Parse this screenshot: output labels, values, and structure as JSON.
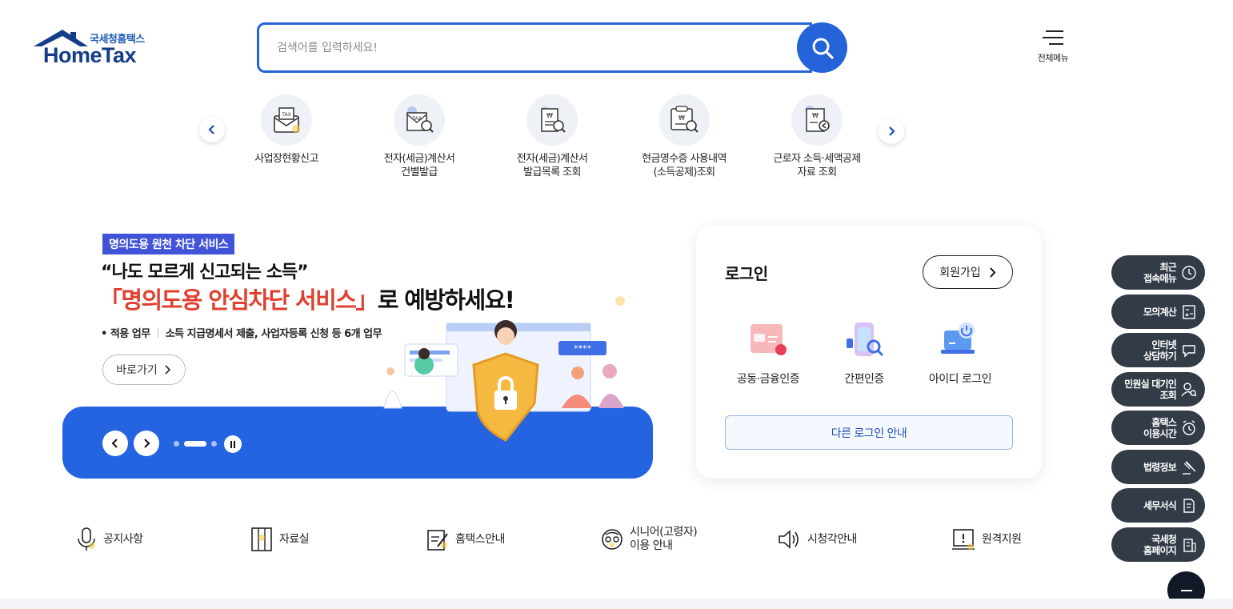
{
  "header": {
    "logo_small": "국세청홈택스",
    "logo_big": "HomeTax",
    "search_placeholder": "검색어를 입력하세요!",
    "all_menu_label": "전체메뉴"
  },
  "quick_menu": {
    "items": [
      {
        "label": "사업장현황신고",
        "icon": "tax-envelope-icon"
      },
      {
        "label": "전자(세금)계산서\n건별발급",
        "icon": "tax-invoice-search-icon"
      },
      {
        "label": "전자(세금)계산서\n발급목록 조회",
        "icon": "invoice-list-search-icon"
      },
      {
        "label": "현금영수증 사용내역\n(소득공제)조회",
        "icon": "receipt-search-icon"
      },
      {
        "label": "근로자 소득·세액공제\n자료 조회",
        "icon": "deduction-document-icon"
      }
    ]
  },
  "banner": {
    "tag": "명의도용 원천 차단 서비스",
    "subtitle": "“나도 모르게 신고되는 소득”",
    "main_highlight": "「명의도용 안심차단 서비스」",
    "main_rest": "로 예방하세요!",
    "detail_prefix": "• 적용 업무",
    "detail_text": "소득 지급명세서 제출, 사업자등록 신청 등 6개 업무",
    "go_label": "바로가기",
    "illustration_code": "****"
  },
  "login": {
    "title": "로그인",
    "join_label": "회원가입",
    "options": [
      {
        "label": "공동·금융인증",
        "icon": "certificate-icon"
      },
      {
        "label": "간편인증",
        "icon": "simple-auth-icon"
      },
      {
        "label": "아이디 로그인",
        "icon": "id-login-icon"
      }
    ],
    "other_login": "다른 로그인 안내"
  },
  "bottom_links": [
    {
      "label": "공지사항",
      "icon": "microphone-icon"
    },
    {
      "label": "자료실",
      "icon": "archive-icon"
    },
    {
      "label": "홈택스안내",
      "icon": "guide-edit-icon"
    },
    {
      "label": "시니어(고령자)\n이용 안내",
      "icon": "senior-icon"
    },
    {
      "label": "시청각안내",
      "icon": "speaker-icon"
    },
    {
      "label": "원격지원",
      "icon": "remote-support-icon"
    }
  ],
  "right_menu": [
    {
      "label": "최근\n접속메뉴",
      "icon": "clock-icon"
    },
    {
      "label": "모의계산",
      "icon": "calculator-icon"
    },
    {
      "label": "인터넷\n상담하기",
      "icon": "chat-icon"
    },
    {
      "label": "민원실 대기인\n조회",
      "icon": "person-search-icon"
    },
    {
      "label": "홈택스\n이용시간",
      "icon": "alarm-clock-icon"
    },
    {
      "label": "법령정보",
      "icon": "gavel-icon"
    },
    {
      "label": "세무서식",
      "icon": "form-document-icon"
    },
    {
      "label": "국세청\n홈페이지",
      "icon": "building-icon"
    }
  ],
  "colors": {
    "brand_blue": "#2563d8",
    "banner_blue": "#2564e0",
    "highlight_red": "#e0402f",
    "tag_purple": "#4153d6",
    "dark_panel": "#333b47"
  }
}
